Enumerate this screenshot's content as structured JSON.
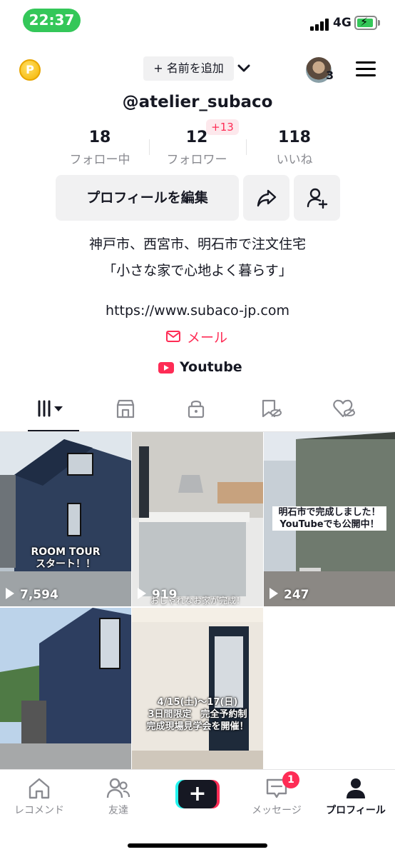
{
  "status_bar": {
    "time": "22:37",
    "network": "4G"
  },
  "header": {
    "add_name_label": "+ 名前を追加",
    "avatar_count": "3",
    "coin_letter": "P",
    "username": "@atelier_subaco"
  },
  "stats": {
    "following": {
      "value": "18",
      "label": "フォロー中"
    },
    "followers": {
      "value": "12",
      "label": "フォロワー",
      "delta": "+13"
    },
    "likes": {
      "value": "118",
      "label": "いいね"
    }
  },
  "actions": {
    "edit_profile": "プロフィールを編集"
  },
  "bio": {
    "line1": "神戸市、西宮市、明石市で注文住宅",
    "line2": "「小さな家で心地よく暮らす」",
    "url": "https://www.subaco-jp.com",
    "mail_label": "メール",
    "youtube_label": "Youtube"
  },
  "videos": [
    {
      "views": "7,594",
      "caption": "ROOM TOUR\nスタート！！"
    },
    {
      "views": "919",
      "caption": "おしゃれなお家が完成！"
    },
    {
      "views": "247",
      "caption": "明石市で完成しました！\nYouTubeでも公開中！"
    },
    {
      "views": "",
      "caption": ""
    },
    {
      "views": "",
      "caption": "4/15(土)〜17(日)\n3日間限定　完全予約制\n完成現場見学会を開催！"
    }
  ],
  "nav": {
    "home": "レコメンド",
    "friends": "友達",
    "messages": "メッセージ",
    "messages_badge": "1",
    "profile": "プロフィール"
  },
  "colors": {
    "accent_red": "#fe2c55",
    "accent_cyan": "#25f4ee",
    "status_green": "#34c759",
    "text_primary": "#161823",
    "text_secondary": "#8a8b91"
  }
}
